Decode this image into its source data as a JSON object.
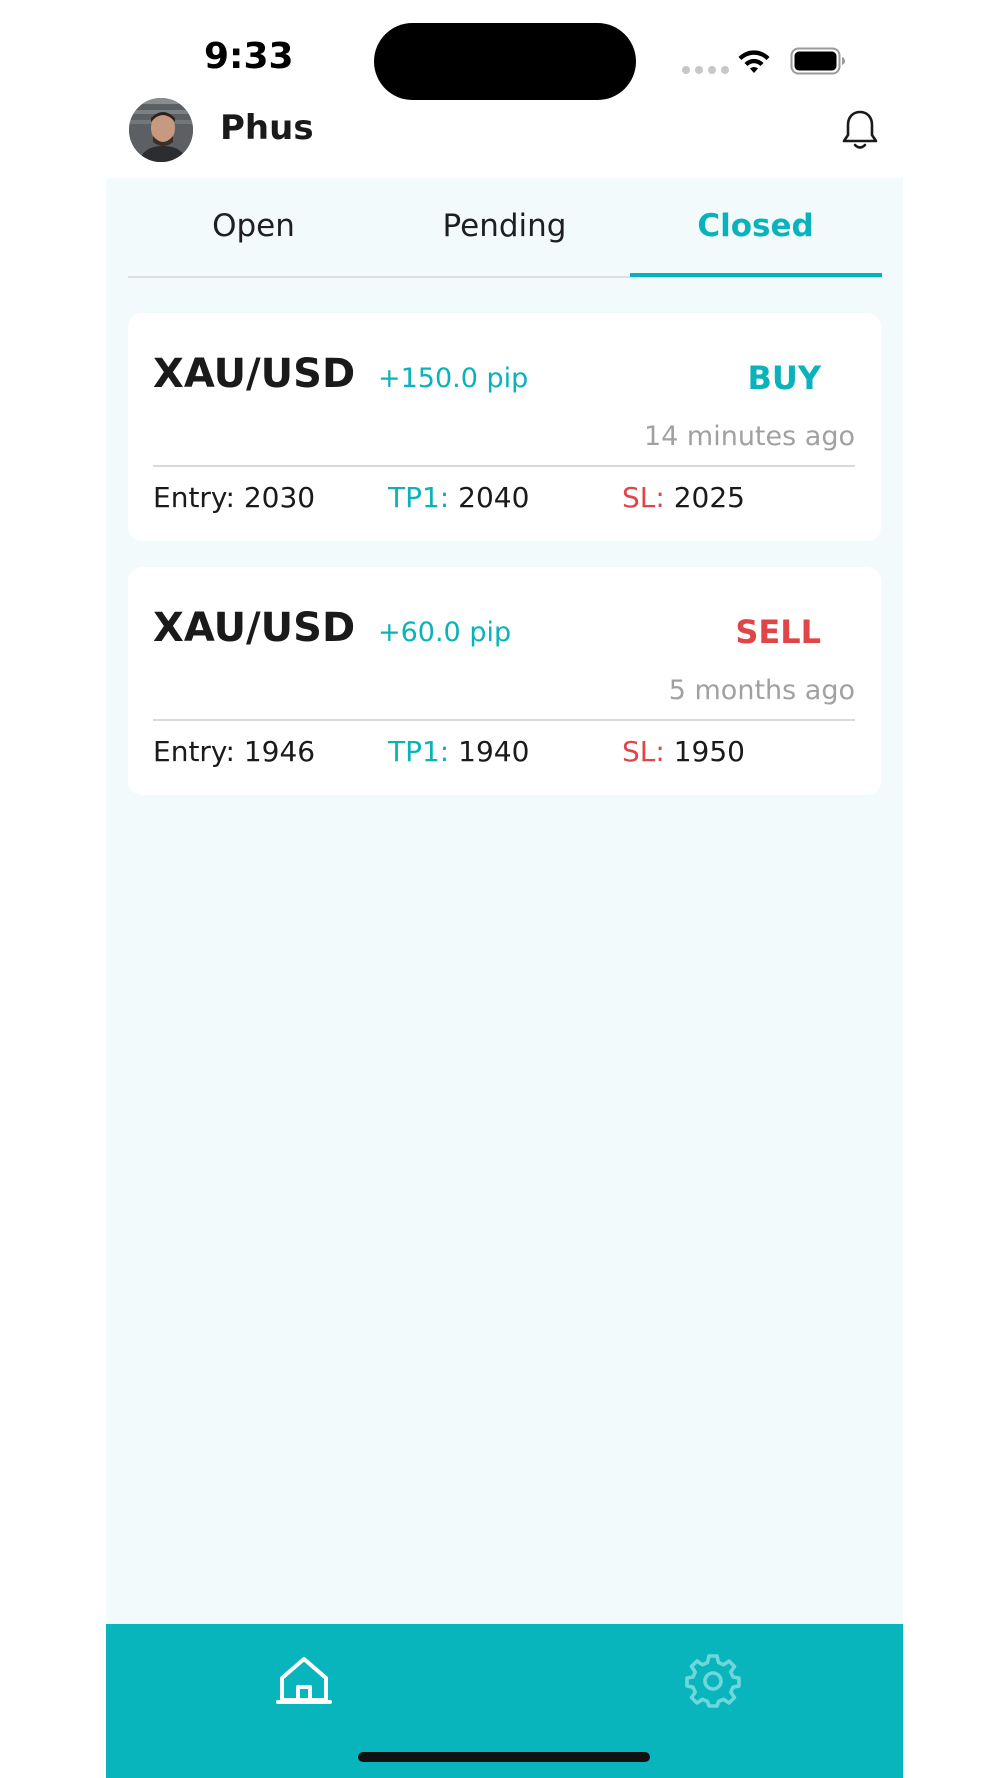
{
  "status_bar": {
    "time": "9:33"
  },
  "header": {
    "user_name": "Phus",
    "avatar_icon": "user-avatar-photo",
    "notification_icon": "bell-icon"
  },
  "tabs": [
    {
      "label": "Open",
      "active": false
    },
    {
      "label": "Pending",
      "active": false
    },
    {
      "label": "Closed",
      "active": true
    }
  ],
  "trades": [
    {
      "pair": "XAU/USD",
      "pips": "+150.0 pip",
      "side": "BUY",
      "time_ago": "14 minutes ago",
      "entry_label": "Entry:",
      "entry_value": "2030",
      "tp_label": "TP1:",
      "tp_value": "2040",
      "sl_label": "SL:",
      "sl_value": "2025"
    },
    {
      "pair": "XAU/USD",
      "pips": "+60.0 pip",
      "side": "SELL",
      "time_ago": "5 months ago",
      "entry_label": "Entry:",
      "entry_value": "1946",
      "tp_label": "TP1:",
      "tp_value": "1940",
      "sl_label": "SL:",
      "sl_value": "1950"
    }
  ],
  "bottom_nav": {
    "items": [
      {
        "icon": "home-icon",
        "active": true
      },
      {
        "icon": "gear-icon",
        "active": false
      }
    ]
  },
  "colors": {
    "accent": "#0ab3bb",
    "sell": "#e0454a",
    "panel_bg": "#f3fafc",
    "nav_bg": "#09b5bc"
  }
}
